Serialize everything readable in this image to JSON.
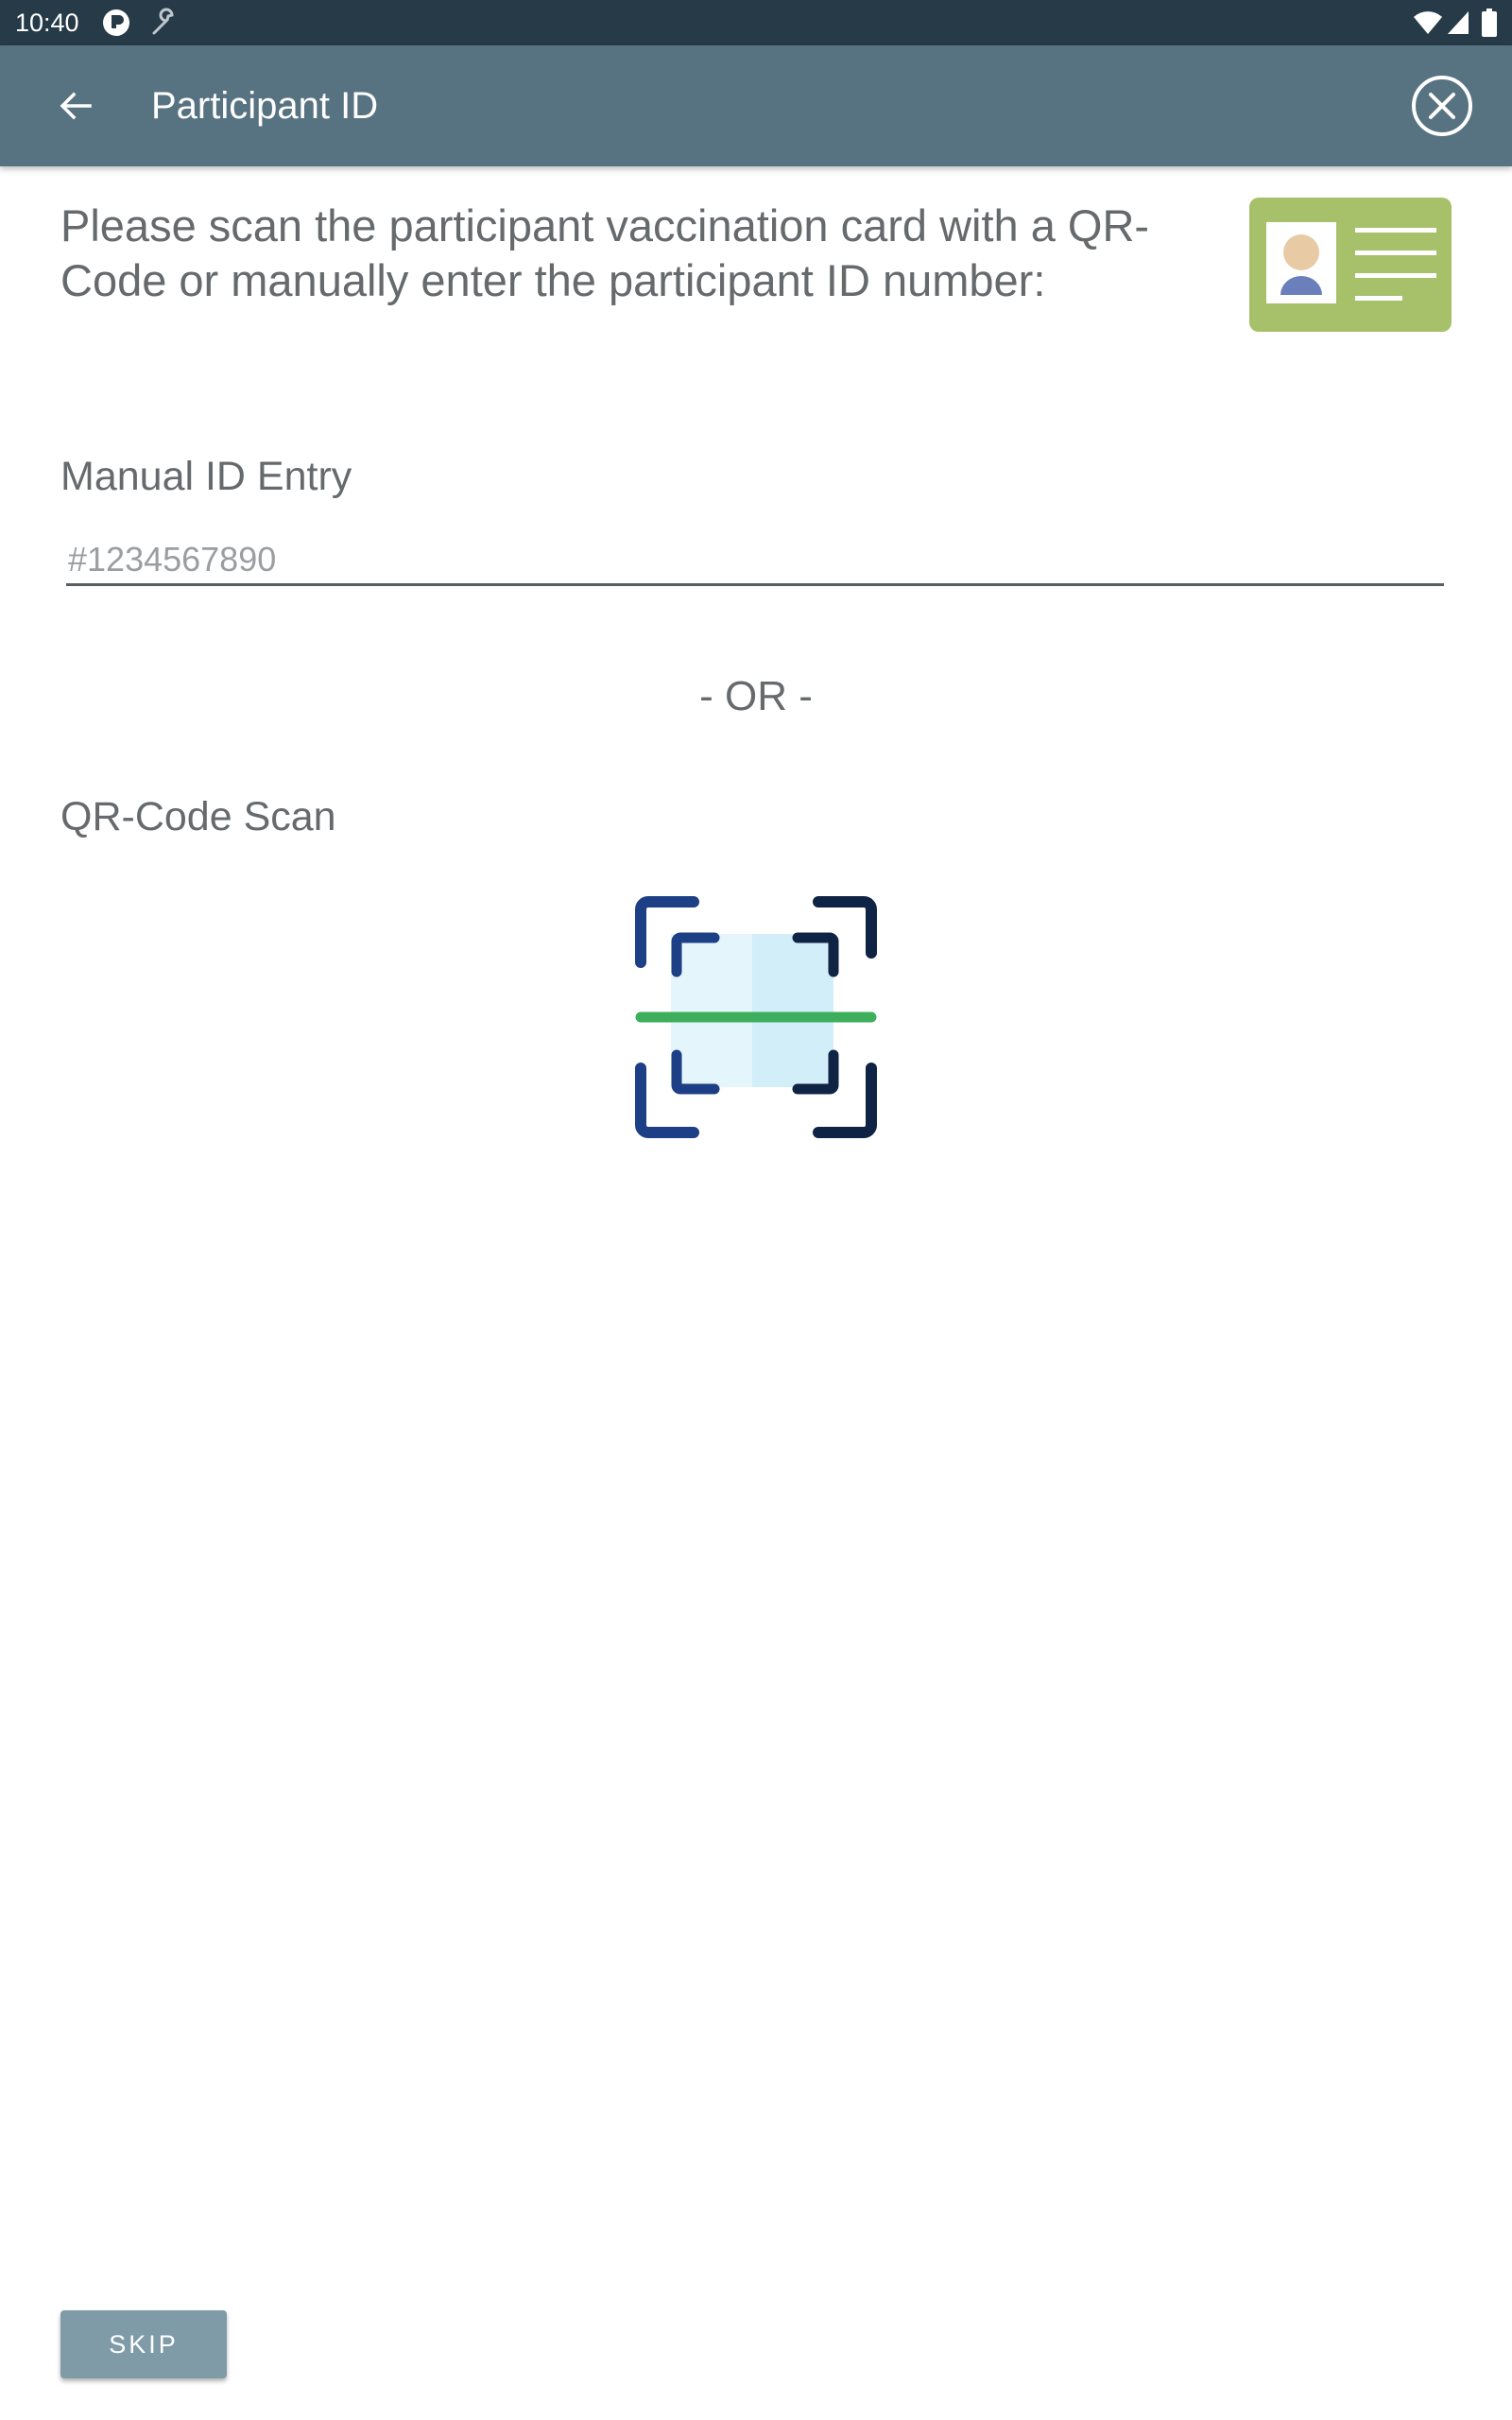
{
  "status_bar": {
    "time": "10:40",
    "left_icons": [
      "notification-app-icon",
      "wrench-icon"
    ],
    "right_icons": [
      "wifi-icon",
      "cell-signal-icon",
      "battery-icon"
    ]
  },
  "app_bar": {
    "title": "Participant ID",
    "back_icon": "arrow-back-icon",
    "close_icon": "close-circle-icon"
  },
  "main": {
    "instructions": "Please scan the participant vaccination card with a QR-Code or manually enter the participant ID number:",
    "id_card_icon": "id-card-icon",
    "manual_entry": {
      "label": "Manual ID Entry",
      "placeholder": "#1234567890",
      "value": ""
    },
    "or_divider": "- OR -",
    "qr_scan": {
      "label": "QR-Code Scan",
      "icon": "qr-scan-icon"
    }
  },
  "footer": {
    "skip_label": "SKIP"
  },
  "colors": {
    "status_bar": "#263a48",
    "app_bar": "#577280",
    "text_secondary": "#666a6d",
    "skip_button": "#7f9ba8",
    "id_card_bg": "#a7c06a",
    "scan_line": "#3cae5c",
    "scan_corner_dark": "#0f2345",
    "scan_corner_blue": "#1d3f86"
  }
}
